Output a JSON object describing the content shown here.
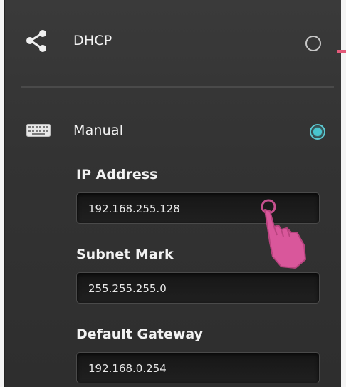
{
  "dhcp": {
    "label": "DHCP",
    "icon": "share-icon",
    "selected": false
  },
  "manual": {
    "label": "Manual",
    "icon": "keyboard-icon",
    "selected": true
  },
  "fields": {
    "ip": {
      "label": "IP Address",
      "value": "192.168.255.128"
    },
    "subnet": {
      "label": "Subnet Mark",
      "value": "255.255.255.0"
    },
    "gateway": {
      "label": "Default Gateway",
      "value": "192.168.0.254"
    }
  },
  "colors": {
    "panel": "#333333",
    "accent_radio": "#49c6cf",
    "pointer": "#d9579b"
  }
}
